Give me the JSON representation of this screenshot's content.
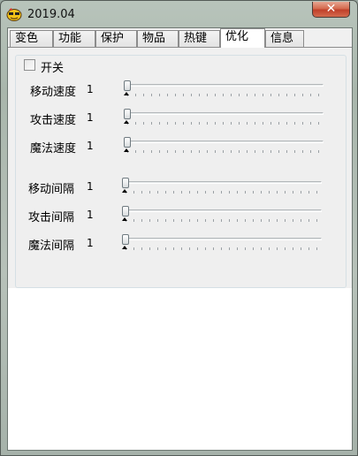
{
  "window": {
    "title": "2019.04",
    "close_label": "✕"
  },
  "tabs": [
    {
      "label": "变色"
    },
    {
      "label": "功能"
    },
    {
      "label": "保护"
    },
    {
      "label": "物品"
    },
    {
      "label": "热键"
    },
    {
      "label": "优化"
    },
    {
      "label": "信息"
    }
  ],
  "active_tab": "优化",
  "optimize": {
    "toggle": {
      "label": "开关",
      "checked": false
    },
    "rows": [
      {
        "label": "移动速度",
        "value": "1"
      },
      {
        "label": "攻击速度",
        "value": "1"
      },
      {
        "label": "魔法速度",
        "value": "1"
      },
      {
        "label": "移动间隔",
        "value": "1"
      },
      {
        "label": "攻击间隔",
        "value": "1"
      },
      {
        "label": "魔法间隔",
        "value": "1"
      }
    ]
  }
}
